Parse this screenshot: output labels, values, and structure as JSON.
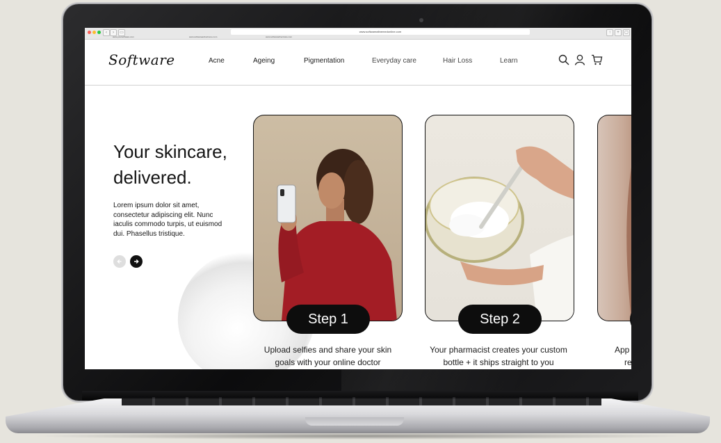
{
  "browser": {
    "address": "www.softwarealtnemedonline.com",
    "tabs": [
      "www.yoursoftware.com",
      "www.softwareactivehome.com",
      "www.softwaredirectcare.com"
    ]
  },
  "site": {
    "logo": "Software",
    "nav": [
      "Acne",
      "Ageing",
      "Pigmentation",
      "Everyday care",
      "Hair Loss",
      "Learn"
    ],
    "icons": [
      "search-icon",
      "account-icon",
      "cart-icon"
    ]
  },
  "hero": {
    "headline_line1": "Your skincare,",
    "headline_line2": "delivered.",
    "body": "Lorem ipsum dolor sit amet, consectetur adipiscing elit. Nunc iaculis commodo turpis, ut euismod dui. Phasellus tristique."
  },
  "steps": [
    {
      "label": "Step 1",
      "caption_line1": "Upload selfies and share your skin",
      "caption_line2": "goals with your online doctor"
    },
    {
      "label": "Step 2",
      "caption_line1": "Your pharmacist creates your custom",
      "caption_line2": "bottle + it ships straight to you"
    },
    {
      "caption_line1": "App",
      "caption_line2": "re"
    }
  ],
  "colors": {
    "accent": "#111111",
    "background": "#ffffff",
    "sweater": "#a31d25"
  }
}
